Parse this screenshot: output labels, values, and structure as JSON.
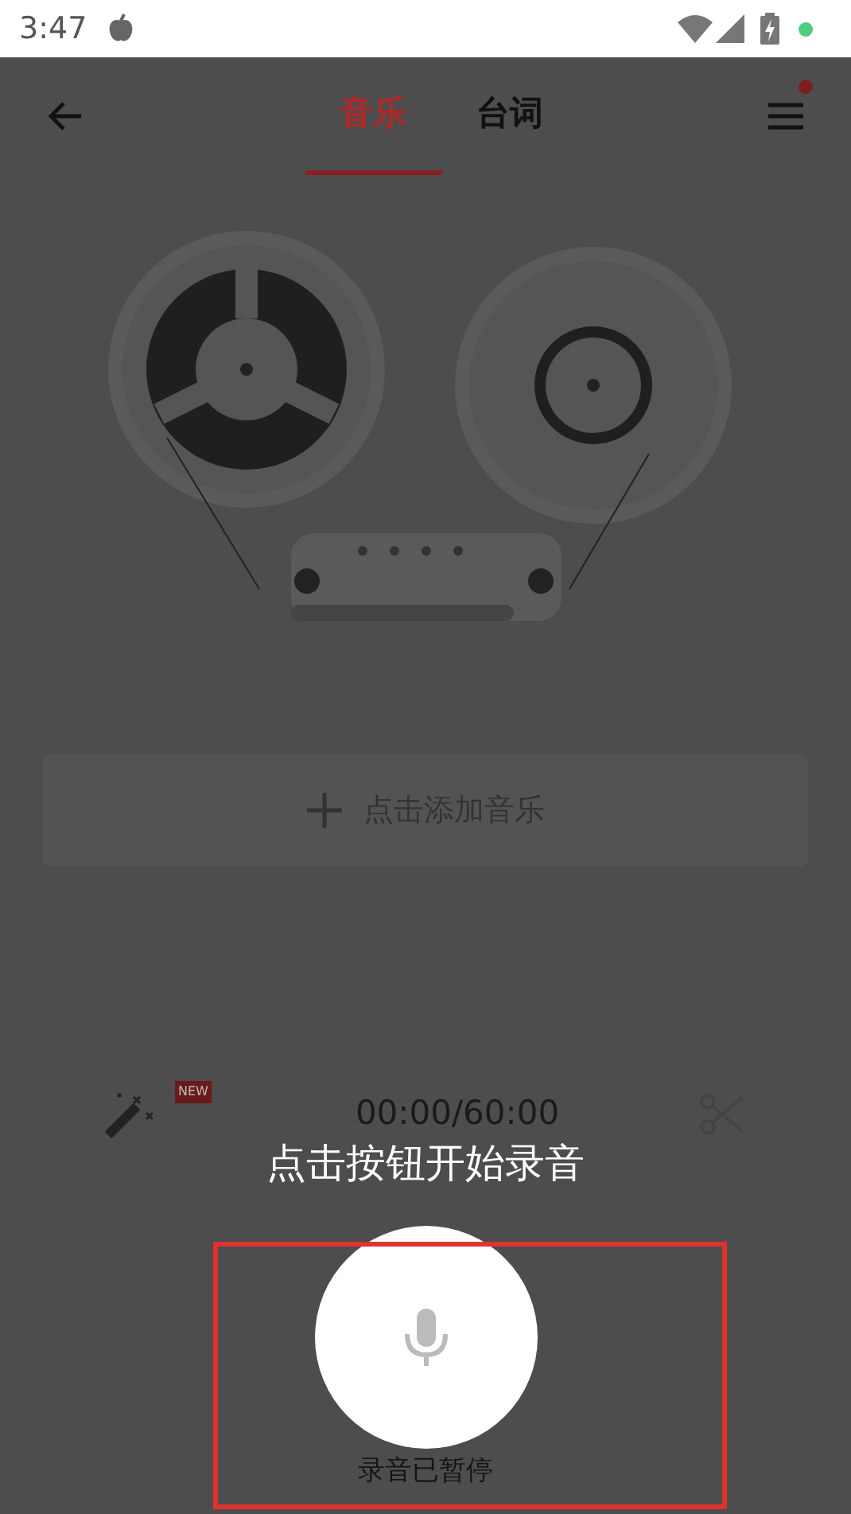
{
  "status_bar": {
    "time": "3:47"
  },
  "tabs": [
    {
      "label": "音乐",
      "selected": true
    },
    {
      "label": "台词",
      "selected": false
    }
  ],
  "menu": {
    "notification": true
  },
  "add_music": {
    "label": "点击添加音乐"
  },
  "tools": {
    "new_badge": "NEW",
    "timer": "00:00/60:00"
  },
  "hint": "点击按钮开始录音",
  "record": {
    "status": "录音已暂停"
  },
  "highlight": true
}
